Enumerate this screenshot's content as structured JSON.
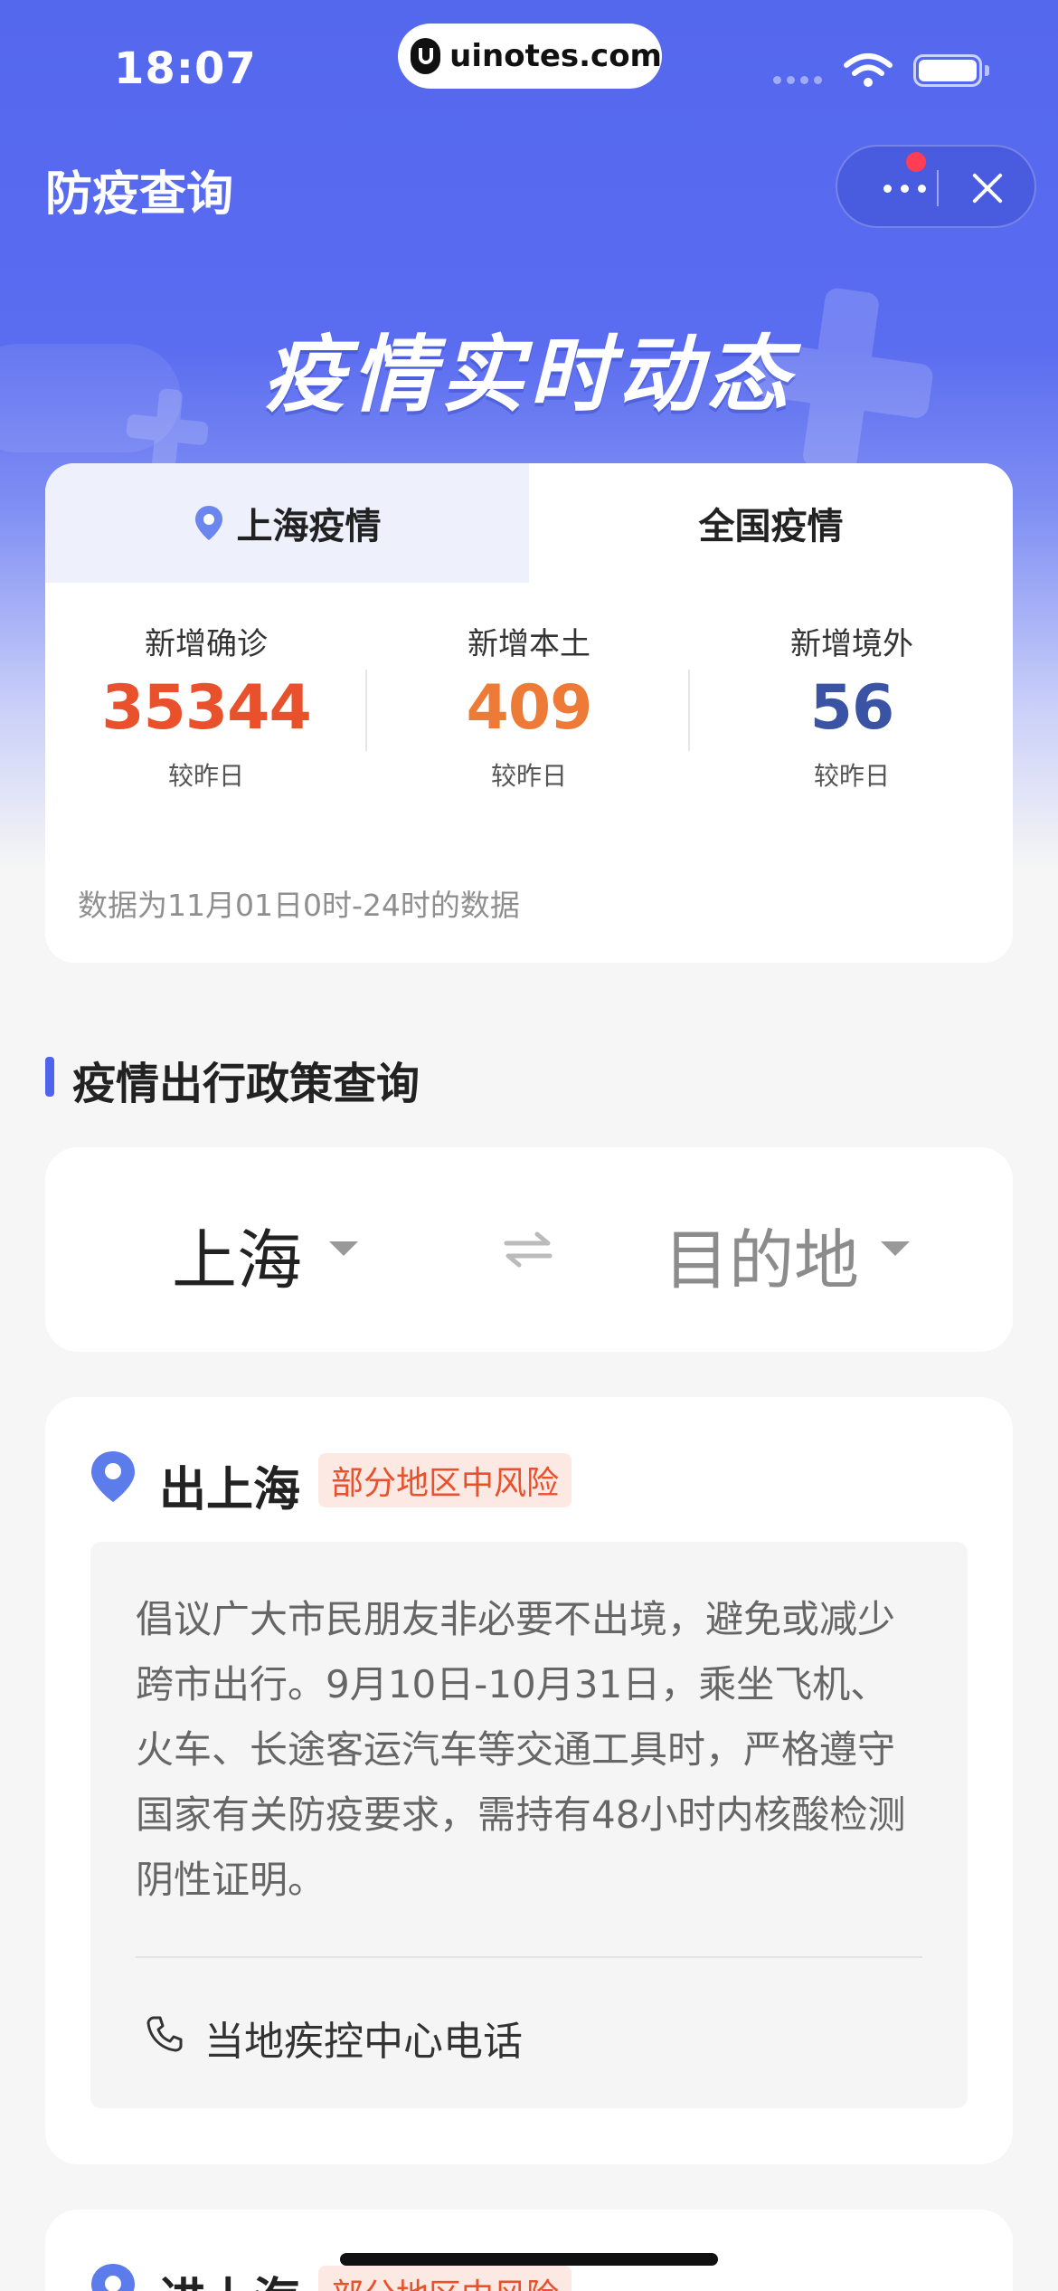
{
  "status_bar": {
    "time": "18:07",
    "url": "uinotes.com"
  },
  "nav": {
    "title": "防疫查询"
  },
  "hero": {
    "title": "疫情实时动态"
  },
  "stats": {
    "tabs": [
      {
        "label": "上海疫情",
        "active": true
      },
      {
        "label": "全国疫情",
        "active": false
      }
    ],
    "items": [
      {
        "label": "新增确诊",
        "value": "35344",
        "sub": "较昨日",
        "color": "#e8512b"
      },
      {
        "label": "新增本土",
        "value": "409",
        "sub": "较昨日",
        "color": "#ed7a37"
      },
      {
        "label": "新增境外",
        "value": "56",
        "sub": "较昨日",
        "color": "#3a53a4"
      }
    ],
    "note": "数据为11月01日0时-24时的数据"
  },
  "section": {
    "title": "疫情出行政策查询"
  },
  "route": {
    "from": "上海",
    "to": "目的地"
  },
  "policy": {
    "title": "出上海",
    "risk": "部分地区中风险",
    "text": "倡议广大市民朋友非必要不出境，避免或减少跨市出行。9月10日-10月31日，乘坐飞机、火车、长途客运汽车等交通工具时，严格遵守国家有关防疫要求，需持有48小时内核酸检测阴性证明。",
    "phone_label": "当地疾控中心电话"
  },
  "next_policy": {
    "title": "进上海",
    "risk": "部分地区中风险"
  },
  "colors": {
    "brand": "#5468ee",
    "accent_bar": "#4f63ec",
    "risk": "#e8512b"
  }
}
